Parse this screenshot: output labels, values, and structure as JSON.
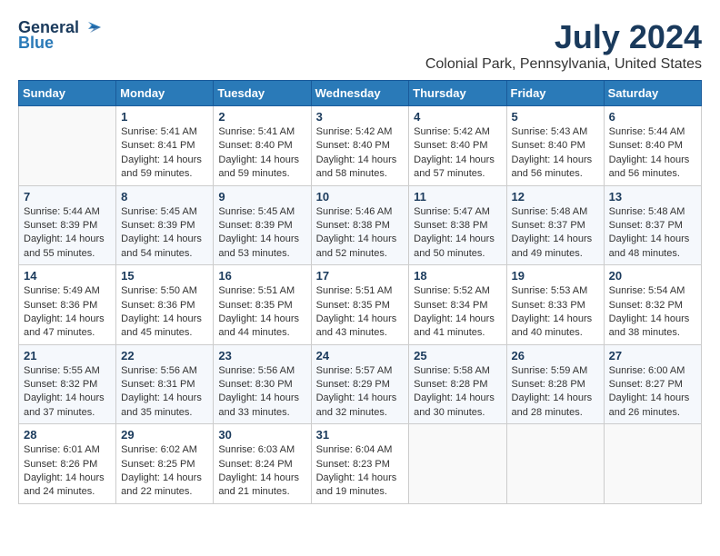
{
  "header": {
    "logo_general": "General",
    "logo_blue": "Blue",
    "month": "July 2024",
    "location": "Colonial Park, Pennsylvania, United States"
  },
  "weekdays": [
    "Sunday",
    "Monday",
    "Tuesday",
    "Wednesday",
    "Thursday",
    "Friday",
    "Saturday"
  ],
  "weeks": [
    [
      {
        "day": "",
        "sunrise": "",
        "sunset": "",
        "daylight": ""
      },
      {
        "day": "1",
        "sunrise": "Sunrise: 5:41 AM",
        "sunset": "Sunset: 8:41 PM",
        "daylight": "Daylight: 14 hours and 59 minutes."
      },
      {
        "day": "2",
        "sunrise": "Sunrise: 5:41 AM",
        "sunset": "Sunset: 8:40 PM",
        "daylight": "Daylight: 14 hours and 59 minutes."
      },
      {
        "day": "3",
        "sunrise": "Sunrise: 5:42 AM",
        "sunset": "Sunset: 8:40 PM",
        "daylight": "Daylight: 14 hours and 58 minutes."
      },
      {
        "day": "4",
        "sunrise": "Sunrise: 5:42 AM",
        "sunset": "Sunset: 8:40 PM",
        "daylight": "Daylight: 14 hours and 57 minutes."
      },
      {
        "day": "5",
        "sunrise": "Sunrise: 5:43 AM",
        "sunset": "Sunset: 8:40 PM",
        "daylight": "Daylight: 14 hours and 56 minutes."
      },
      {
        "day": "6",
        "sunrise": "Sunrise: 5:44 AM",
        "sunset": "Sunset: 8:40 PM",
        "daylight": "Daylight: 14 hours and 56 minutes."
      }
    ],
    [
      {
        "day": "7",
        "sunrise": "Sunrise: 5:44 AM",
        "sunset": "Sunset: 8:39 PM",
        "daylight": "Daylight: 14 hours and 55 minutes."
      },
      {
        "day": "8",
        "sunrise": "Sunrise: 5:45 AM",
        "sunset": "Sunset: 8:39 PM",
        "daylight": "Daylight: 14 hours and 54 minutes."
      },
      {
        "day": "9",
        "sunrise": "Sunrise: 5:45 AM",
        "sunset": "Sunset: 8:39 PM",
        "daylight": "Daylight: 14 hours and 53 minutes."
      },
      {
        "day": "10",
        "sunrise": "Sunrise: 5:46 AM",
        "sunset": "Sunset: 8:38 PM",
        "daylight": "Daylight: 14 hours and 52 minutes."
      },
      {
        "day": "11",
        "sunrise": "Sunrise: 5:47 AM",
        "sunset": "Sunset: 8:38 PM",
        "daylight": "Daylight: 14 hours and 50 minutes."
      },
      {
        "day": "12",
        "sunrise": "Sunrise: 5:48 AM",
        "sunset": "Sunset: 8:37 PM",
        "daylight": "Daylight: 14 hours and 49 minutes."
      },
      {
        "day": "13",
        "sunrise": "Sunrise: 5:48 AM",
        "sunset": "Sunset: 8:37 PM",
        "daylight": "Daylight: 14 hours and 48 minutes."
      }
    ],
    [
      {
        "day": "14",
        "sunrise": "Sunrise: 5:49 AM",
        "sunset": "Sunset: 8:36 PM",
        "daylight": "Daylight: 14 hours and 47 minutes."
      },
      {
        "day": "15",
        "sunrise": "Sunrise: 5:50 AM",
        "sunset": "Sunset: 8:36 PM",
        "daylight": "Daylight: 14 hours and 45 minutes."
      },
      {
        "day": "16",
        "sunrise": "Sunrise: 5:51 AM",
        "sunset": "Sunset: 8:35 PM",
        "daylight": "Daylight: 14 hours and 44 minutes."
      },
      {
        "day": "17",
        "sunrise": "Sunrise: 5:51 AM",
        "sunset": "Sunset: 8:35 PM",
        "daylight": "Daylight: 14 hours and 43 minutes."
      },
      {
        "day": "18",
        "sunrise": "Sunrise: 5:52 AM",
        "sunset": "Sunset: 8:34 PM",
        "daylight": "Daylight: 14 hours and 41 minutes."
      },
      {
        "day": "19",
        "sunrise": "Sunrise: 5:53 AM",
        "sunset": "Sunset: 8:33 PM",
        "daylight": "Daylight: 14 hours and 40 minutes."
      },
      {
        "day": "20",
        "sunrise": "Sunrise: 5:54 AM",
        "sunset": "Sunset: 8:32 PM",
        "daylight": "Daylight: 14 hours and 38 minutes."
      }
    ],
    [
      {
        "day": "21",
        "sunrise": "Sunrise: 5:55 AM",
        "sunset": "Sunset: 8:32 PM",
        "daylight": "Daylight: 14 hours and 37 minutes."
      },
      {
        "day": "22",
        "sunrise": "Sunrise: 5:56 AM",
        "sunset": "Sunset: 8:31 PM",
        "daylight": "Daylight: 14 hours and 35 minutes."
      },
      {
        "day": "23",
        "sunrise": "Sunrise: 5:56 AM",
        "sunset": "Sunset: 8:30 PM",
        "daylight": "Daylight: 14 hours and 33 minutes."
      },
      {
        "day": "24",
        "sunrise": "Sunrise: 5:57 AM",
        "sunset": "Sunset: 8:29 PM",
        "daylight": "Daylight: 14 hours and 32 minutes."
      },
      {
        "day": "25",
        "sunrise": "Sunrise: 5:58 AM",
        "sunset": "Sunset: 8:28 PM",
        "daylight": "Daylight: 14 hours and 30 minutes."
      },
      {
        "day": "26",
        "sunrise": "Sunrise: 5:59 AM",
        "sunset": "Sunset: 8:28 PM",
        "daylight": "Daylight: 14 hours and 28 minutes."
      },
      {
        "day": "27",
        "sunrise": "Sunrise: 6:00 AM",
        "sunset": "Sunset: 8:27 PM",
        "daylight": "Daylight: 14 hours and 26 minutes."
      }
    ],
    [
      {
        "day": "28",
        "sunrise": "Sunrise: 6:01 AM",
        "sunset": "Sunset: 8:26 PM",
        "daylight": "Daylight: 14 hours and 24 minutes."
      },
      {
        "day": "29",
        "sunrise": "Sunrise: 6:02 AM",
        "sunset": "Sunset: 8:25 PM",
        "daylight": "Daylight: 14 hours and 22 minutes."
      },
      {
        "day": "30",
        "sunrise": "Sunrise: 6:03 AM",
        "sunset": "Sunset: 8:24 PM",
        "daylight": "Daylight: 14 hours and 21 minutes."
      },
      {
        "day": "31",
        "sunrise": "Sunrise: 6:04 AM",
        "sunset": "Sunset: 8:23 PM",
        "daylight": "Daylight: 14 hours and 19 minutes."
      },
      {
        "day": "",
        "sunrise": "",
        "sunset": "",
        "daylight": ""
      },
      {
        "day": "",
        "sunrise": "",
        "sunset": "",
        "daylight": ""
      },
      {
        "day": "",
        "sunrise": "",
        "sunset": "",
        "daylight": ""
      }
    ]
  ]
}
